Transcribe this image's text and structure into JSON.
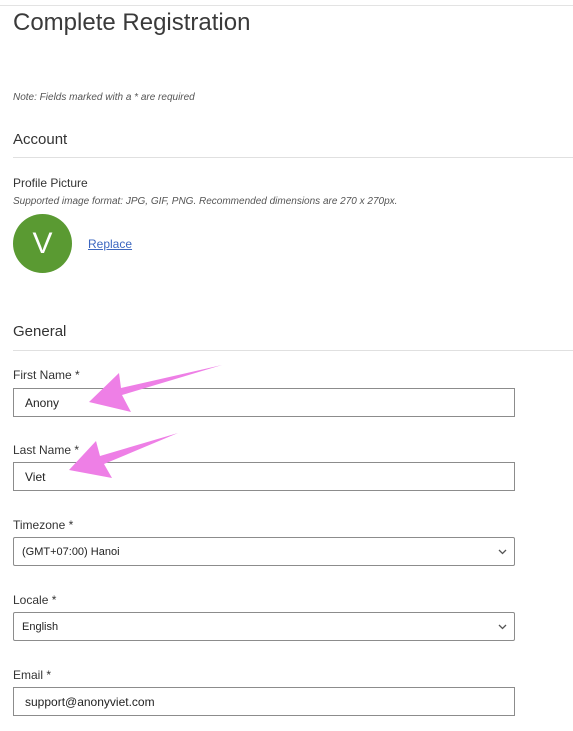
{
  "page": {
    "title": "Complete Registration",
    "note": "Note: Fields marked with a * are required"
  },
  "account": {
    "heading": "Account",
    "profile_label": "Profile Picture",
    "profile_hint": "Supported image format: JPG, GIF, PNG. Recommended dimensions are 270 x 270px.",
    "avatar_letter": "V",
    "avatar_color": "#5a9a32",
    "replace_label": "Replace"
  },
  "general": {
    "heading": "General",
    "first_name": {
      "label": "First Name *",
      "value": "Anony"
    },
    "last_name": {
      "label": "Last Name *",
      "value": "Viet"
    },
    "timezone": {
      "label": "Timezone *",
      "value": "(GMT+07:00) Hanoi"
    },
    "locale": {
      "label": "Locale *",
      "value": "English"
    },
    "email": {
      "label": "Email *",
      "value": "support@anonyviet.com"
    }
  },
  "annotations": {
    "arrow_color": "#ee7fe6"
  }
}
